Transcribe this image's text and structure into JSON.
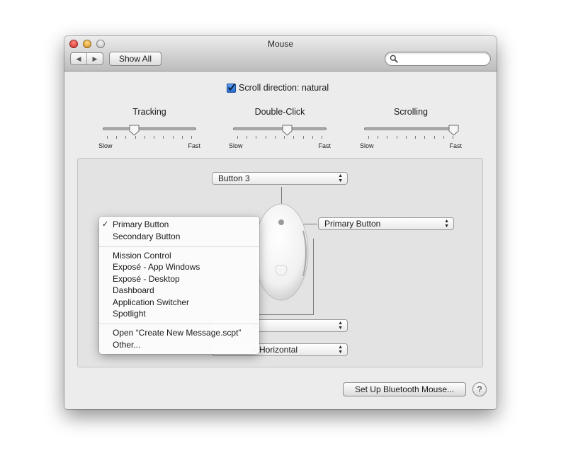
{
  "window": {
    "title": "Mouse"
  },
  "toolbar": {
    "back_icon": "back-arrow-icon",
    "forward_icon": "forward-arrow-icon",
    "show_all": "Show All",
    "search_value": "",
    "search_icon": "magnifier-icon"
  },
  "options": {
    "scroll_direction": "Scroll direction: natural",
    "scroll_checked": true
  },
  "sliders": [
    {
      "title": "Tracking",
      "min_label": "Slow",
      "max_label": "Fast",
      "level": 0.34
    },
    {
      "title": "Double-Click",
      "min_label": "Slow",
      "max_label": "Fast",
      "level": 0.58
    },
    {
      "title": "Scrolling",
      "min_label": "Slow",
      "max_label": "Fast",
      "level": 0.96
    }
  ],
  "mouse_config": {
    "top_popup": "Button 3",
    "right_popup": "Primary Button",
    "bottom_popup_1_visible": "d",
    "bottom_popup_2_visible": "d Horizontal"
  },
  "menu": {
    "selected": "Primary Button",
    "groups": [
      [
        "Primary Button",
        "Secondary Button"
      ],
      [
        "Mission Control",
        "Exposé - App Windows",
        "Exposé - Desktop",
        "Dashboard",
        "Application Switcher",
        "Spotlight"
      ],
      [
        "Open “Create New Message.scpt”",
        "Other..."
      ]
    ]
  },
  "footer": {
    "bluetooth_button": "Set Up Bluetooth Mouse...",
    "help": "?"
  },
  "colors": {
    "close": "#e0463f",
    "minimize": "#e3a43a",
    "zoom": "#d6d6d6",
    "checkbox": "#2a6fd0"
  }
}
